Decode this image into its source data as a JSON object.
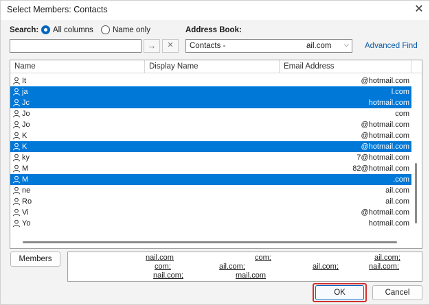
{
  "window": {
    "title": "Select Members: Contacts",
    "close_glyph": "✕"
  },
  "search": {
    "label": "Search:",
    "options": [
      {
        "label": "All columns",
        "selected": true
      },
      {
        "label": "Name only",
        "selected": false
      }
    ],
    "value": "",
    "go_glyph": "→",
    "clear_glyph": "✕"
  },
  "address_book": {
    "label": "Address Book:",
    "value_left": "Contacts -",
    "value_right": "ail.com",
    "chevron": "⌵"
  },
  "advanced_find": "Advanced Find",
  "list": {
    "columns": [
      "Name",
      "Display Name",
      "Email Address"
    ],
    "rows": [
      {
        "name": "It",
        "email": "@hotmail.com",
        "selected": false
      },
      {
        "name": "ja",
        "email": "l.com",
        "selected": true
      },
      {
        "name": "Jc",
        "email": "hotmail.com",
        "selected": true
      },
      {
        "name": "Jo",
        "email": "com",
        "selected": false
      },
      {
        "name": "Jo",
        "email": "@hotmail.com",
        "selected": false
      },
      {
        "name": "K",
        "email": "@hotmail.com",
        "selected": false
      },
      {
        "name": "K",
        "email": "@hotmail.com",
        "selected": true
      },
      {
        "name": "ky",
        "email": "7@hotmail.com",
        "selected": false
      },
      {
        "name": "M",
        "email": "82@hotmail.com",
        "selected": false
      },
      {
        "name": "M",
        "email": ".com",
        "selected": true
      },
      {
        "name": "ne",
        "email": "ail.com",
        "selected": false
      },
      {
        "name": "Ro",
        "email": "ail.com",
        "selected": false
      },
      {
        "name": "Vi",
        "email": "@hotmail.com",
        "selected": false
      },
      {
        "name": "Yo",
        "email": "hotmail.com",
        "selected": false
      }
    ]
  },
  "members": {
    "button_label": "Members",
    "line1": [
      "nail.com",
      "com;",
      "ail.com;"
    ],
    "line2": [
      "com;",
      "ail.com;",
      "ail.com;",
      "nail.com;"
    ],
    "line3": [
      "nail.com;",
      "mail.com"
    ]
  },
  "footer": {
    "ok_label": "OK",
    "cancel_label": "Cancel"
  },
  "colors": {
    "selection": "#0078d7",
    "link": "#0f5ea8",
    "highlight_outline": "#d32f2f"
  }
}
